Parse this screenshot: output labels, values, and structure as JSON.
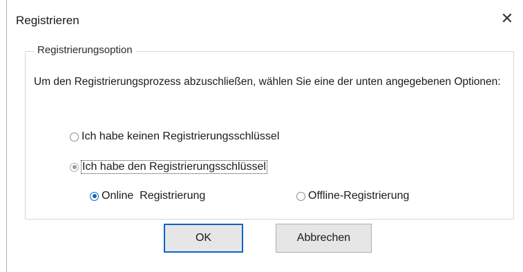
{
  "window": {
    "title": "Registrieren",
    "close_symbol": "✕"
  },
  "group": {
    "legend": "Registrierungsoption",
    "description": "Um den Registrierungsprozess abzuschließen, wählen Sie eine der unten angegebenen Optionen:"
  },
  "options": {
    "no_key": {
      "label": "Ich habe keinen Registrierungsschlüssel",
      "checked": false
    },
    "have_key": {
      "label": "Ich habe den Registrierungsschlüssel",
      "checked": true
    },
    "online": {
      "label": "Online  Registrierung",
      "checked": true
    },
    "offline": {
      "label": "Offline-Registrierung",
      "checked": false
    }
  },
  "buttons": {
    "ok_label": "OK",
    "cancel_label": "Abbrechen"
  },
  "colors": {
    "accent": "#0a64c8",
    "group_border": "#d6d6d6",
    "button_bg": "#e6e6e6"
  },
  "icons": {
    "close": "close-icon",
    "radio": "radio-icon"
  }
}
